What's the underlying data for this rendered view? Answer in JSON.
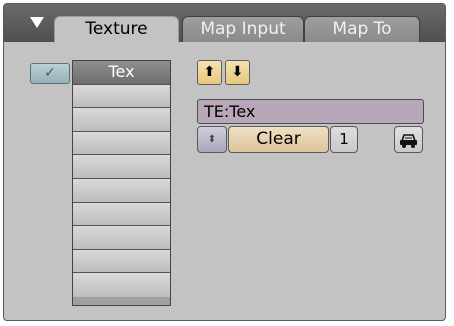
{
  "tabs": [
    {
      "label": "Texture",
      "active": true
    },
    {
      "label": "Map Input",
      "active": false
    },
    {
      "label": "Map To",
      "active": false
    }
  ],
  "channels": {
    "check_glyph": "✓",
    "slots": [
      "Tex",
      "",
      "",
      "",
      "",
      "",
      "",
      "",
      "",
      ""
    ]
  },
  "arrows": {
    "up": "⬆",
    "down": "⬇"
  },
  "texture_block": {
    "name": "TE:Tex",
    "browse_glyph": "⬍",
    "clear_label": "Clear",
    "users_count": "1",
    "fake_user_icon": "car-icon"
  },
  "colors": {
    "panel_bg": "#c3c3c3",
    "header_bg": "#5a5a5a",
    "name_field": "#b8a7b8",
    "clear_btn": "#ddc49c",
    "arrow_btn": "#e8c77d",
    "selected_slot": "#7a7a7a"
  }
}
